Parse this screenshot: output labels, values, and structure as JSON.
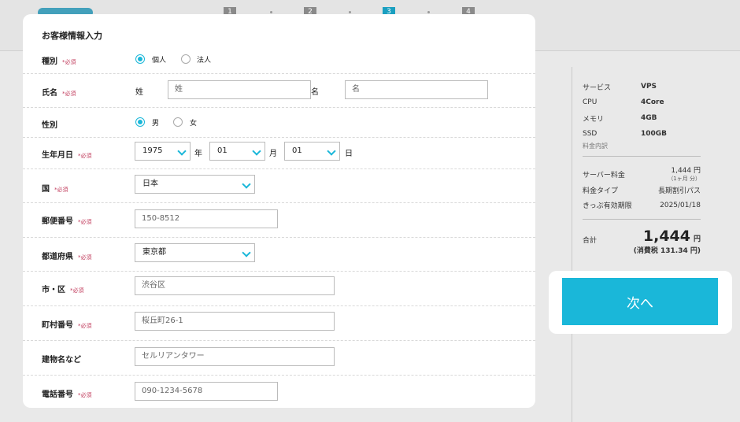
{
  "background": {
    "steps": [
      "1",
      "2",
      "3",
      "4"
    ],
    "active_step": 3
  },
  "summary": {
    "specs": [
      {
        "key": "サービス",
        "value": "VPS"
      },
      {
        "key": "CPU",
        "value": "4Core"
      },
      {
        "key": "メモリ",
        "value": "4GB"
      },
      {
        "key": "SSD",
        "value": "100GB"
      }
    ],
    "breakdown_label": "料金内訳",
    "server_fee_label": "サーバー料金",
    "server_fee_value": "1,444 円",
    "server_fee_period": "（1ヶ月 分）",
    "fee_type_label": "料金タイプ",
    "fee_type_value": "長期割引パス",
    "ticket_label": "きっぷ有効期限",
    "ticket_value": "2025/01/18",
    "total_label": "合計",
    "total_value": "1,444",
    "total_unit": "円",
    "tax_text": "(消費税 131.34 円)"
  },
  "next_button": {
    "label": "次へ"
  },
  "form": {
    "title": "お客様情報入力",
    "required_mark": "*必須",
    "type": {
      "label": "種別",
      "options": [
        "個人",
        "法人"
      ],
      "selected": 0
    },
    "name": {
      "label": "氏名",
      "last_label": "姓",
      "last_placeholder": "姓",
      "first_label": "名",
      "first_placeholder": "名"
    },
    "gender": {
      "label": "性別",
      "options": [
        "男",
        "女"
      ],
      "selected": 0
    },
    "birth": {
      "label": "生年月日",
      "year": "1975",
      "year_unit": "年",
      "month": "01",
      "month_unit": "月",
      "day": "01",
      "day_unit": "日"
    },
    "country": {
      "label": "国",
      "value": "日本"
    },
    "postal": {
      "label": "郵便番号",
      "placeholder": "150-8512"
    },
    "prefecture": {
      "label": "都道府県",
      "value": "東京都"
    },
    "city": {
      "label": "市・区",
      "placeholder": "渋谷区"
    },
    "town": {
      "label": "町村番号",
      "placeholder": "桜丘町26-1"
    },
    "building": {
      "label": "建物名など",
      "placeholder": "セルリアンタワー"
    },
    "phone": {
      "label": "電話番号",
      "placeholder": "090-1234-5678"
    }
  }
}
